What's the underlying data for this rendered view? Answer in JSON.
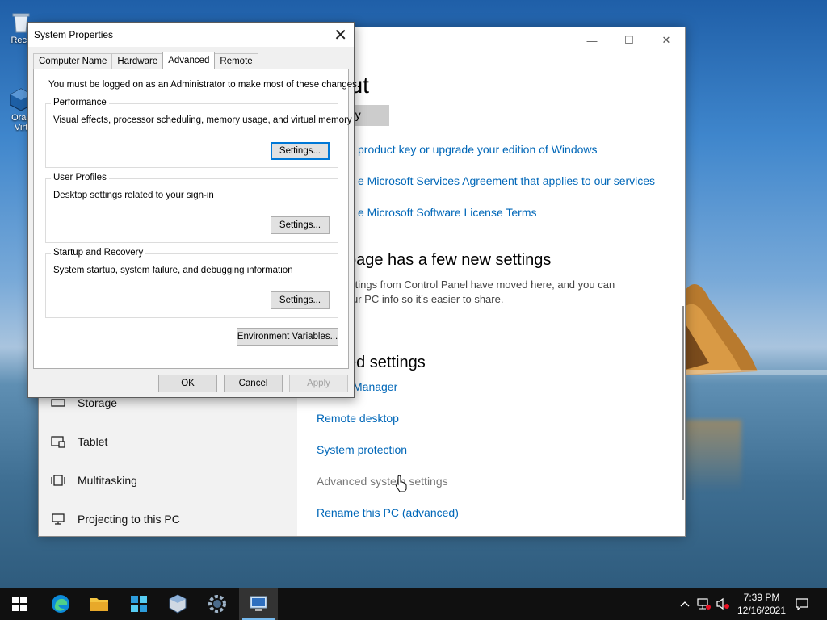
{
  "desktop": {
    "icons": [
      {
        "label": "Recy",
        "icon": "recycle-bin-icon"
      },
      {
        "label": "Orac\nVirt",
        "icon": "virtualbox-icon"
      }
    ]
  },
  "settings": {
    "window_controls": {
      "minimize": "—",
      "maximize": "☐",
      "close": "✕"
    },
    "nav": [
      {
        "label": "Storage",
        "icon": "storage-icon"
      },
      {
        "label": "Tablet",
        "icon": "tablet-icon"
      },
      {
        "label": "Multitasking",
        "icon": "multitasking-icon"
      },
      {
        "label": "Projecting to this PC",
        "icon": "projecting-icon"
      }
    ],
    "heading": "out",
    "copy_button": "py",
    "links_top": [
      "product key or upgrade your edition of Windows",
      "e Microsoft Services Agreement that applies to our services",
      "e Microsoft Software License Terms"
    ],
    "new_settings_heading": "page has a few new settings",
    "new_settings_body_1": "ttings from Control Panel have moved here, and you can",
    "new_settings_body_2": "ur PC info so it's easier to share.",
    "related_heading": "ed settings",
    "related_links": {
      "device_manager": "Manager",
      "remote_desktop": "Remote desktop",
      "system_protection": "System protection",
      "advanced_system_settings": "Advanced system settings",
      "rename_pc": "Rename this PC (advanced)"
    }
  },
  "sysprops": {
    "title": "System Properties",
    "close": "✕",
    "tabs": [
      "Computer Name",
      "Hardware",
      "Advanced",
      "Remote"
    ],
    "active_tab": "Advanced",
    "note": "You must be logged on as an Administrator to make most of these changes.",
    "groups": [
      {
        "title": "Performance",
        "desc": "Visual effects, processor scheduling, memory usage, and virtual memory",
        "button": "Settings..."
      },
      {
        "title": "User Profiles",
        "desc": "Desktop settings related to your sign-in",
        "button": "Settings..."
      },
      {
        "title": "Startup and Recovery",
        "desc": "System startup, system failure, and debugging information",
        "button": "Settings..."
      }
    ],
    "env_button": "Environment Variables...",
    "ok": "OK",
    "cancel": "Cancel",
    "apply": "Apply"
  },
  "taskbar": {
    "apps": [
      "start-icon",
      "edge-icon",
      "file-explorer-icon",
      "store-icon",
      "virtualbox-icon",
      "settings-icon",
      "system-properties-icon"
    ],
    "active_app": "system-properties-icon",
    "time": "7:39 PM",
    "date": "12/16/2021"
  },
  "colors": {
    "accent": "#0078d7",
    "link": "#0067b8",
    "taskbar": "#101010"
  }
}
